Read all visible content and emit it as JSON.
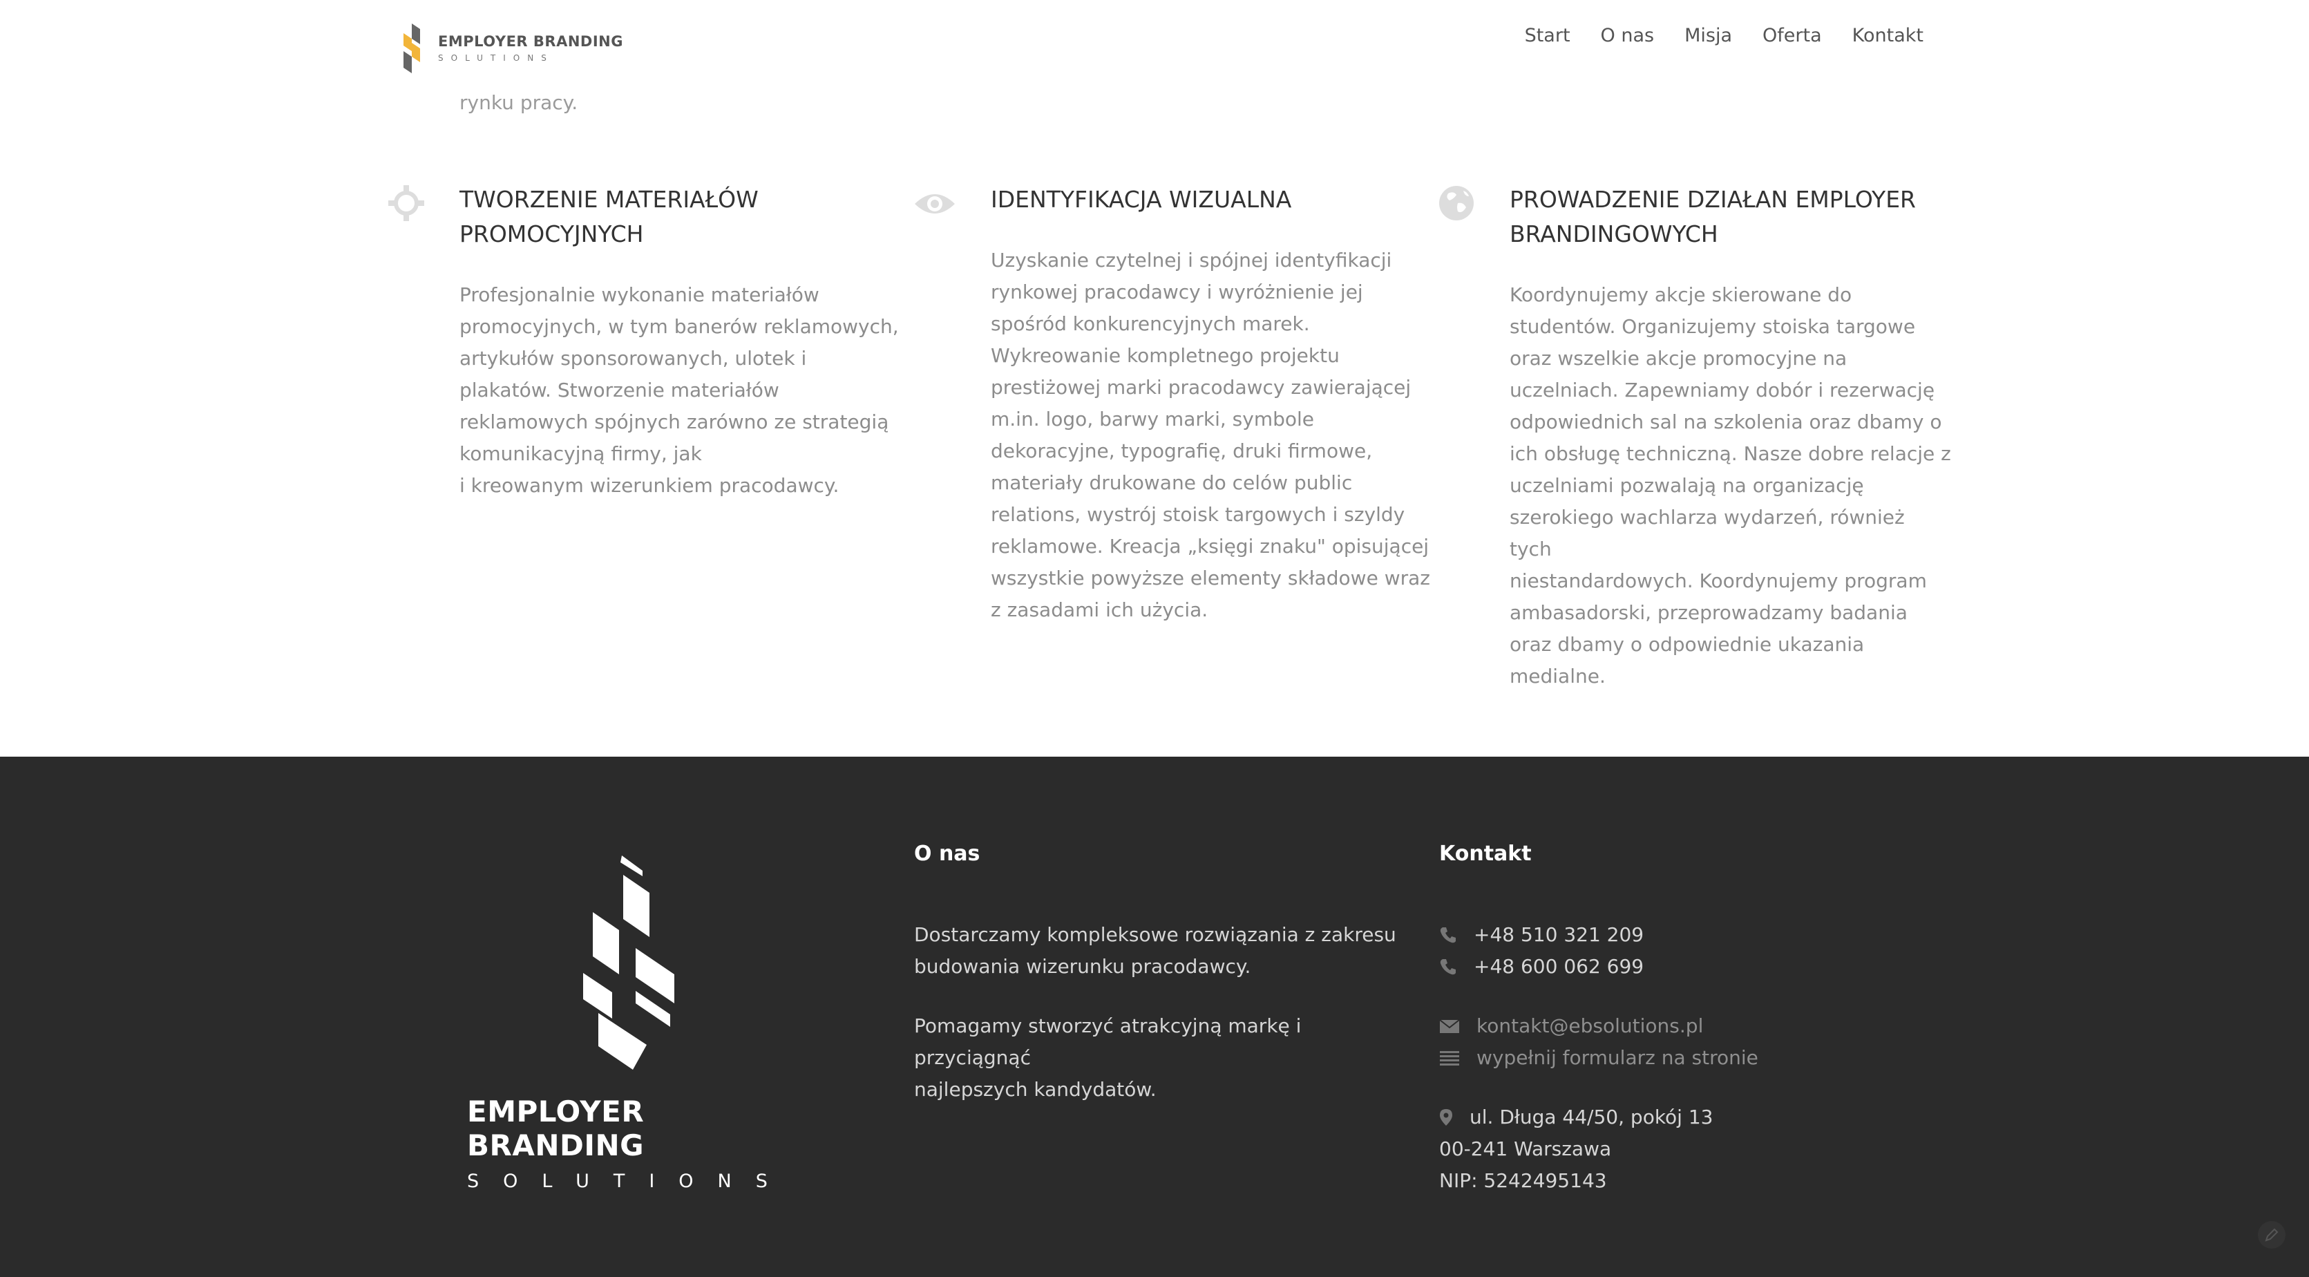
{
  "header": {
    "logo_title": "EMPLOYER BRANDING",
    "logo_subtitle": "SOLUTIONS",
    "nav": [
      "Start",
      "O nas",
      "Misja",
      "Oferta",
      "Kontakt"
    ]
  },
  "clipped_text": "rynku pracy.",
  "services": [
    {
      "icon": "crosshair-icon",
      "title_lines": [
        "TWORZENIE MATERIAŁÓW",
        "PROMOCYJNYCH"
      ],
      "text_lines": [
        "Profesjonalnie wykonanie materiałów",
        "promocyjnych, w tym banerów reklamowych,",
        "artykułów sponsorowanych, ulotek i",
        "plakatów. Stworzenie materiałów",
        "reklamowych spójnych zarówno ze strategią",
        "komunikacyjną firmy, jak",
        "i kreowanym wizerunkiem pracodawcy."
      ]
    },
    {
      "icon": "eye-icon",
      "title_lines": [
        "IDENTYFIKACJA WIZUALNA"
      ],
      "text_lines": [
        "Uzyskanie czytelnej i spójnej identyfikacji",
        "rynkowej pracodawcy i wyróżnienie jej",
        "spośród konkurencyjnych marek.",
        "Wykreowanie kompletnego projektu",
        "prestiżowej marki pracodawcy zawierającej",
        "m.in. logo, barwy marki, symbole",
        "dekoracyjne, typografię, druki firmowe,",
        "materiały drukowane do celów public",
        "relations, wystrój stoisk targowych i szyldy",
        "reklamowe. Kreacja „księgi znaku\" opisującej",
        "wszystkie powyższe elementy składowe wraz",
        "z zasadami ich użycia."
      ]
    },
    {
      "icon": "globe-icon",
      "title_lines": [
        "PROWADZENIE DZIAŁAN EMPLOYER",
        "BRANDINGOWYCH"
      ],
      "text_lines": [
        "Koordynujemy akcje skierowane do",
        "studentów. Organizujemy stoiska targowe",
        "oraz wszelkie akcje promocyjne na",
        "uczelniach. Zapewniamy dobór i rezerwację",
        "odpowiednich sal na szkolenia oraz dbamy o",
        "ich obsługę techniczną. Nasze dobre relacje z",
        "uczelniami pozwalają na organizację",
        "szerokiego wachlarza wydarzeń, również tych",
        "niestandardowych. Koordynujemy program",
        "ambasadorski, przeprowadzamy badania",
        "oraz dbamy o odpowiednie ukazania",
        "medialne."
      ]
    }
  ],
  "footer": {
    "logo_title": "EMPLOYER BRANDING",
    "logo_subtitle": "SOLUTIONS",
    "about_heading": "O nas",
    "about_p1_lines": [
      "Dostarczamy kompleksowe rozwiązania z zakresu",
      "budowania wizerunku pracodawcy."
    ],
    "about_p2_lines": [
      "Pomagamy stworzyć atrakcyjną markę i przyciągnąć",
      "najlepszych kandydatów."
    ],
    "contact_heading": "Kontakt",
    "phone1": "+48 510 321 209",
    "phone2": "+48 600 062 699",
    "email": "kontakt@ebsolutions.pl",
    "form_link": "wypełnij formularz na stronie",
    "address_line1": "ul. Długa 44/50, pokój 13",
    "address_line2": "00-241 Warszawa",
    "nip": "NIP: 5242495143"
  },
  "colors": {
    "accent": "#f2b53a",
    "footer_bg": "#2b2b2b"
  }
}
